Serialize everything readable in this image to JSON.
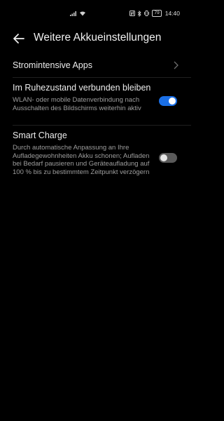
{
  "status_bar": {
    "time": "14:40",
    "battery": "79",
    "icons": [
      "signal-icon",
      "wifi-icon",
      "nfc-icon",
      "bluetooth-icon",
      "vibrate-icon",
      "battery-icon"
    ]
  },
  "header": {
    "title": "Weitere Akkueinstellungen",
    "back_icon": "arrow-left-icon"
  },
  "items": [
    {
      "title": "Stromintensive Apps",
      "has_chevron": true
    },
    {
      "title": "Im Ruhezustand verbunden bleiben",
      "description": "WLAN- oder mobile Datenverbindung nach Ausschalten des Bildschirms weiterhin aktiv",
      "toggle": true
    },
    {
      "title": "Smart Charge",
      "description": "Durch automatische Anpassung an Ihre Aufladegewohnheiten Akku schonen; Aufladen bei Bedarf pausieren und Geräteaufladung auf 100 % bis zu bestimmtem Zeitpunkt verzögern",
      "toggle": false
    }
  ],
  "colors": {
    "background": "#000000",
    "accent": "#1a6fe6",
    "toggle_off": "#5a5a5a"
  }
}
